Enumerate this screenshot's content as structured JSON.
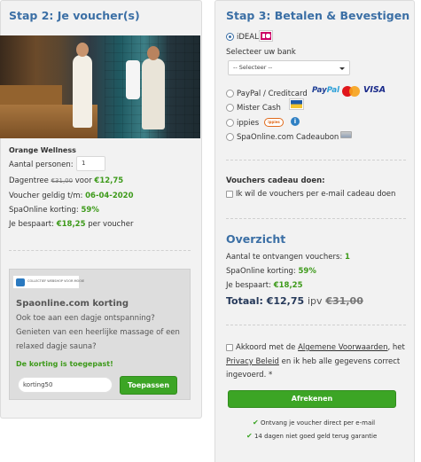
{
  "left": {
    "heading": "Stap 2: Je voucher(s)",
    "product_name": "Orange Wellness",
    "persons_label": "Aantal personen:",
    "persons_value": "1",
    "dagentree_label": "Dagentree",
    "dagentree_old": "€31,00",
    "dagentree_voor": "voor",
    "dagentree_new": "€12,75",
    "valid_label": "Voucher geldig t/m:",
    "valid_date": "06-04-2020",
    "discount_label": "SpaOnline korting:",
    "discount_value": "59%",
    "saved_label": "Je bespaart:",
    "saved_value": "€18,25",
    "saved_suffix": "per voucher"
  },
  "promo": {
    "logo_text": "COLLECTIEF WEBSHOP VOOR MOOIE",
    "title": "Spaonline.com korting",
    "body_line1": "Ook toe aan een dagje ontspanning?",
    "body_line2": "Genieten van een heerlijke massage of een",
    "body_line3": "relaxed dagje sauna?",
    "applied": "De korting is toegepast!",
    "code_value": "korting50",
    "apply_button": "Toepassen"
  },
  "right": {
    "heading": "Stap 3: Betalen & Bevestigen",
    "ideal_label": "iDEAL",
    "bank_label": "Selecteer uw bank",
    "bank_select": "-- Selecteer --",
    "paypal_label": "PayPal / Creditcard",
    "paypal_logo_a": "Pay",
    "paypal_logo_b": "Pal",
    "visa_logo": "VISA",
    "mistercash_label": "Mister Cash",
    "ippies_label": "ippies",
    "ippies_logo": "ippies",
    "info_glyph": "i",
    "cadeaubon_label": "SpaOnline.com Cadeaubon",
    "gift_heading": "Vouchers cadeau doen:",
    "gift_checkbox": "Ik wil de vouchers per e-mail cadeau doen"
  },
  "overview": {
    "heading": "Overzicht",
    "count_label": "Aantal te ontvangen vouchers:",
    "count_value": "1",
    "discount_label": "SpaOnline korting:",
    "discount_value": "59%",
    "saved_label": "Je bespaart:",
    "saved_value": "€18,25",
    "total_label": "Totaal: €12,75",
    "total_ipv": "ipv",
    "total_old": "€31,00"
  },
  "terms": {
    "line1_pre": "Akkoord met de ",
    "line1_link": "Algemene Voorwaarden",
    "line1_post": ", het",
    "line2_link": "Privacy Beleid",
    "line2_post": " en ik heb alle gegevens correct",
    "line3": "ingevoerd. *",
    "checkout_button": "Afrekenen",
    "guarantee1": "Ontvang je voucher direct per e-mail",
    "guarantee2": "14 dagen niet goed geld terug garantie"
  },
  "colors": {
    "accent_blue": "#3b6fa5",
    "green": "#3ca525",
    "panel_bg": "#f2f2f2"
  }
}
